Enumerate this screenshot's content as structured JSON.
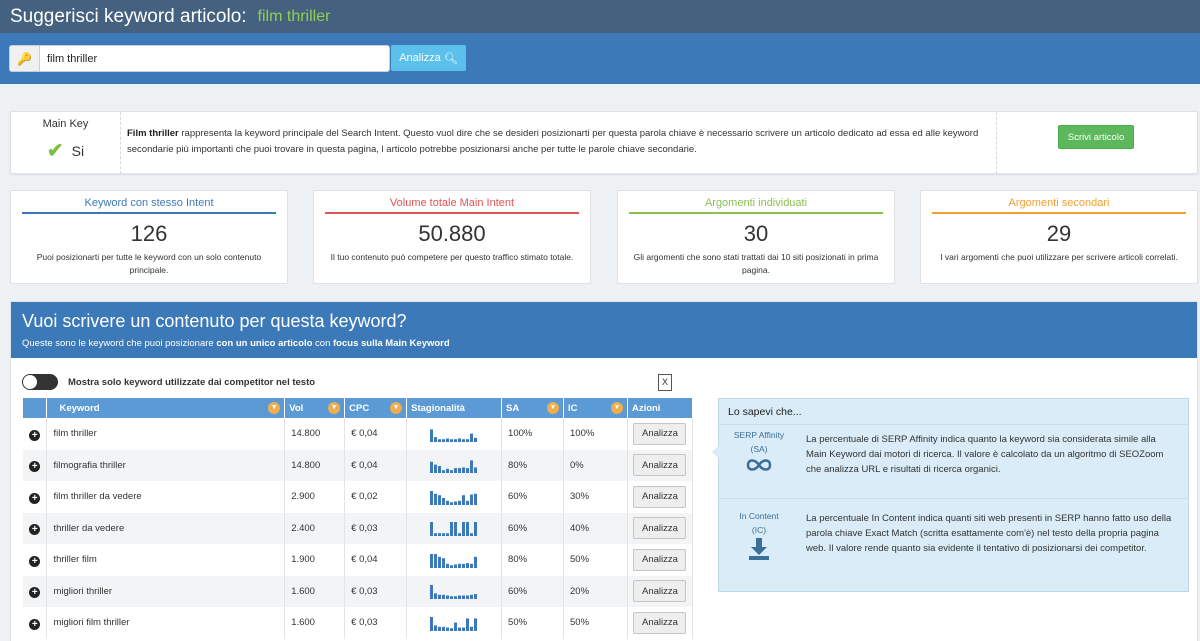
{
  "header": {
    "title": "Suggerisci keyword articolo:",
    "keyword": "film thriller"
  },
  "search": {
    "value": "film thriller",
    "button_label": "Analizza"
  },
  "main_key": {
    "label": "Main Key",
    "value": "Si",
    "keyword": "Film thriller",
    "description": " rappresenta la keyword principale del Search Intent. Questo vuol dire che se desideri posizionarti per questa parola chiave è necessario scrivere un articolo dedicato ad essa ed alle keyword secondarie più importanti che puoi trovare in questa pagina, l articolo potrebbe posizionarsi anche per tutte le parole chiave secondarie.",
    "button_label": "Scrivi articolo"
  },
  "stats": [
    {
      "title": "Keyword con stesso Intent",
      "value": "126",
      "desc": "Puoi posizionarti per tutte le keyword con un solo contenuto principale.",
      "color": "#3c79b9"
    },
    {
      "title": "Volume totale Main Intent",
      "value": "50.880",
      "desc": "Il tuo contenuto può competere per questo traffico stimato totale.",
      "color": "#e05555"
    },
    {
      "title": "Argomenti individuati",
      "value": "30",
      "desc": "Gli argomenti che sono stati trattati dai 10 siti posizionati in prima pagina.",
      "color": "#8cc152"
    },
    {
      "title": "Argomenti secondari",
      "value": "29",
      "desc": "I vari argomenti che puoi utilizzare per scrivere articoli correlati.",
      "color": "#f0a030"
    }
  ],
  "panel": {
    "title": "Vuoi scrivere un contenuto per questa keyword?",
    "subtitle_a": "Queste sono le keyword che puoi posizionare ",
    "subtitle_b": "con un unico articolo",
    "subtitle_c": " con ",
    "subtitle_d": "focus sulla Main Keyword",
    "toggle_label": "Mostra solo keyword utilizzate dai competitor nel testo"
  },
  "table": {
    "headers": [
      "Keyword",
      "Vol",
      "CPC",
      "Stagionalità",
      "SA",
      "IC",
      "Azioni"
    ],
    "action_label": "Analizza",
    "rows": [
      {
        "keyword": "film thriller",
        "vol": "14.800",
        "cpc": "€ 0,04",
        "sa": "100%",
        "ic": "100%",
        "spark": [
          0.9,
          0.35,
          0.2,
          0.2,
          0.25,
          0.2,
          0.2,
          0.25,
          0.2,
          0.2,
          0.6,
          0.3
        ]
      },
      {
        "keyword": "filmografia thriller",
        "vol": "14.800",
        "cpc": "€ 0,04",
        "sa": "80%",
        "ic": "0%",
        "spark": [
          0.8,
          0.6,
          0.5,
          0.2,
          0.3,
          0.2,
          0.35,
          0.35,
          0.4,
          0.35,
          0.9,
          0.4
        ]
      },
      {
        "keyword": "film thriller da vedere",
        "vol": "2.900",
        "cpc": "€ 0,02",
        "sa": "60%",
        "ic": "30%",
        "spark": [
          1.0,
          0.8,
          0.7,
          0.5,
          0.3,
          0.2,
          0.25,
          0.3,
          0.7,
          0.3,
          0.75,
          0.8
        ]
      },
      {
        "keyword": "thriller da vedere",
        "vol": "2.400",
        "cpc": "€ 0,03",
        "sa": "60%",
        "ic": "40%",
        "spark": [
          1.0,
          0.2,
          0.2,
          0.2,
          0.2,
          1.0,
          1.0,
          0.2,
          1.0,
          1.0,
          0.2,
          1.0
        ]
      },
      {
        "keyword": "thriller film",
        "vol": "1.900",
        "cpc": "€ 0,04",
        "sa": "80%",
        "ic": "50%",
        "spark": [
          1.0,
          1.0,
          0.8,
          0.7,
          0.3,
          0.2,
          0.25,
          0.3,
          0.3,
          0.35,
          0.3,
          0.8
        ]
      },
      {
        "keyword": "migliori thriller",
        "vol": "1.600",
        "cpc": "€ 0,03",
        "sa": "60%",
        "ic": "20%",
        "spark": [
          1.0,
          0.4,
          0.3,
          0.3,
          0.25,
          0.2,
          0.2,
          0.25,
          0.25,
          0.25,
          0.3,
          0.35
        ]
      },
      {
        "keyword": "migliori film thriller",
        "vol": "1.600",
        "cpc": "€ 0,03",
        "sa": "50%",
        "ic": "50%",
        "spark": [
          1.0,
          0.4,
          0.3,
          0.3,
          0.25,
          0.2,
          0.6,
          0.25,
          0.25,
          0.9,
          0.3,
          0.9
        ]
      }
    ]
  },
  "info": {
    "title": "Lo sapevi che...",
    "sa_label": "SERP Affinity",
    "sa_abbr": "(SA)",
    "sa_text": "La percentuale di SERP Affinity indica quanto la keyword sia considerata simile alla Main Keyword dai motori di ricerca. Il valore è calcolato da un algoritmo di SEOZoom che analizza URL e risultati di ricerca organici.",
    "ic_label": "In Content",
    "ic_abbr": "(IC)",
    "ic_text": "La percentuale In Content indica quanti siti web presenti in SERP hanno fatto uso della parola chiave Exact Match (scritta esattamente com'è) nel testo della propria pagina web. Il valore rende quanto sia evidente il tentativo di posizionarsi dei competitor."
  }
}
